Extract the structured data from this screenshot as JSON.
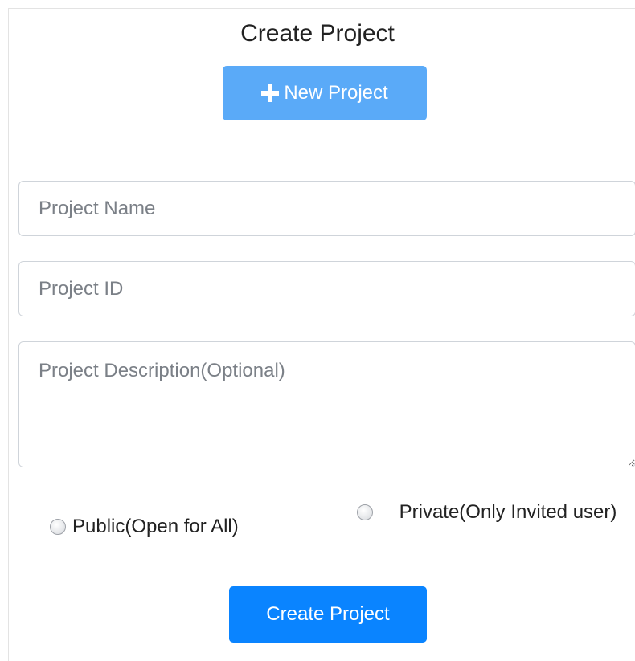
{
  "form": {
    "title": "Create Project",
    "new_project_label": "New Project",
    "project_name_placeholder": "Project Name",
    "project_id_placeholder": "Project ID",
    "description_placeholder": "Project Description(Optional)",
    "visibility_options": [
      {
        "label": "Public(Open for All)",
        "selected": false
      },
      {
        "label": "Private(Only Invited user)",
        "selected": false
      }
    ],
    "submit_label": "Create Project"
  },
  "icons": {
    "new_project": "plus-icon",
    "description_resize": "resize-handle-icon"
  },
  "colors": {
    "new_project_button": "#5aaaf8",
    "submit_button": "#0a84ff",
    "input_border": "#cfd4da"
  }
}
